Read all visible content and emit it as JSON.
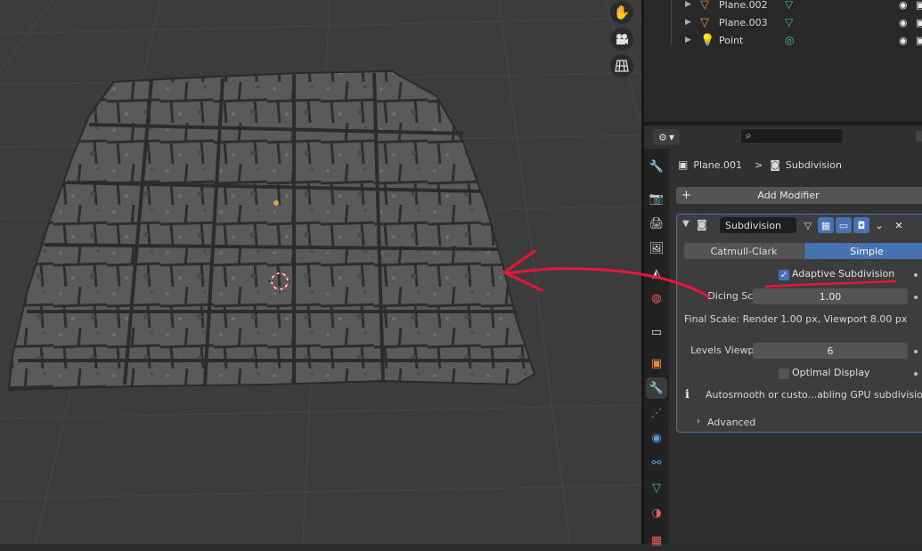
{
  "outliner": {
    "rows": [
      {
        "name": "Plane.002",
        "icon": "mesh-object-icon",
        "data_icon": "mesh-data-icon"
      },
      {
        "name": "Plane.003",
        "icon": "mesh-object-icon",
        "data_icon": "mesh-data-icon"
      },
      {
        "name": "Point",
        "icon": "light-object-icon",
        "data_icon": "light-data-icon"
      }
    ]
  },
  "properties": {
    "breadcrumb": {
      "object": "Plane.001",
      "separator": ">",
      "modifier": "Subdivision"
    },
    "add_modifier": "Add Modifier",
    "modifier": {
      "name": "Subdivision",
      "types": [
        "Catmull-Clark",
        "Simple"
      ],
      "selected_type": "Simple",
      "adaptive_label": "Adaptive Subdivision",
      "adaptive_checked": true,
      "dicing_label": "Dicing Scale",
      "dicing_value": "1.00",
      "final_scale": "Final Scale: Render 1.00 px, Viewport 8.00 px",
      "levels_label": "Levels Viewport",
      "levels_value": "6",
      "optimal_label": "Optimal Display",
      "optimal_checked": false,
      "info": "Autosmooth or custo...abling GPU subdivision",
      "advanced": "Advanced"
    }
  },
  "colors": {
    "accent": "#4772b3",
    "annotation": "#e8173a",
    "mesh_orange": "#e58a3a",
    "light_yellow": "#e0b84a",
    "data_green": "#3fc68a"
  }
}
